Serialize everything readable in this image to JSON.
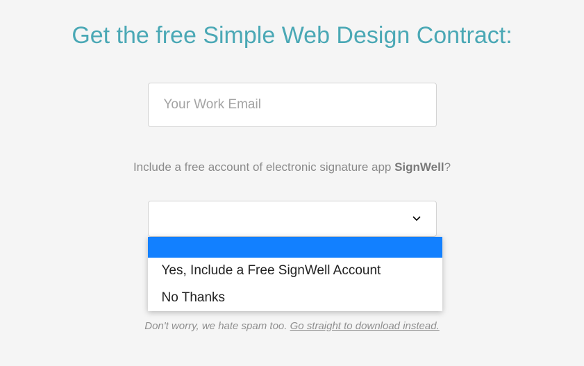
{
  "title": "Get the free Simple Web Design Contract:",
  "email": {
    "placeholder": "Your Work Email",
    "value": ""
  },
  "question": {
    "prefix": "Include a free account of electronic signature app ",
    "brand": "SignWell",
    "suffix": "?"
  },
  "dropdown": {
    "selected": "",
    "options": [
      {
        "label": "",
        "highlighted": true
      },
      {
        "label": "Yes, Include a Free SignWell Account",
        "highlighted": false
      },
      {
        "label": "No Thanks",
        "highlighted": false
      }
    ]
  },
  "footer": {
    "text": "Don't worry, we hate spam too. ",
    "link": "Go straight to download instead."
  }
}
